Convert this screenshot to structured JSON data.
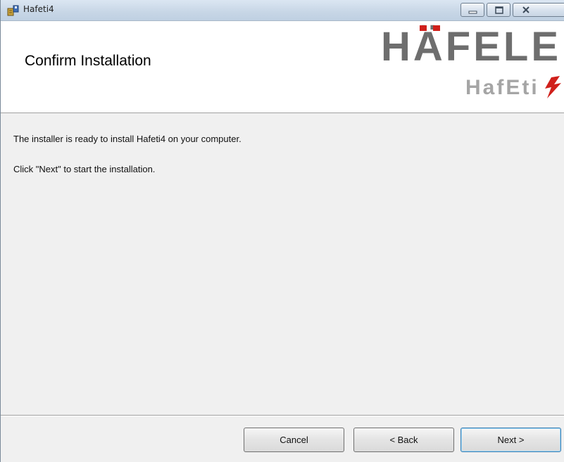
{
  "window": {
    "title": "Hafeti4",
    "title_icon": "installer-package-icon",
    "controls": [
      "minimize-icon",
      "maximize-icon",
      "close-icon"
    ]
  },
  "banner": {
    "heading": "Confirm Installation",
    "logo_brand": "HÄFELE",
    "logo_sub": "HafEti4"
  },
  "content": {
    "line1": "The installer is ready to install Hafeti4 on your computer.",
    "line2": "Click \"Next\" to start the installation."
  },
  "buttons": {
    "cancel": "Cancel",
    "back": "< Back",
    "next": "Next >"
  },
  "colors": {
    "logo_gray": "#6e6e6e",
    "logo_accent_red": "#d0201b",
    "default_button_border": "#3c7fb1"
  }
}
